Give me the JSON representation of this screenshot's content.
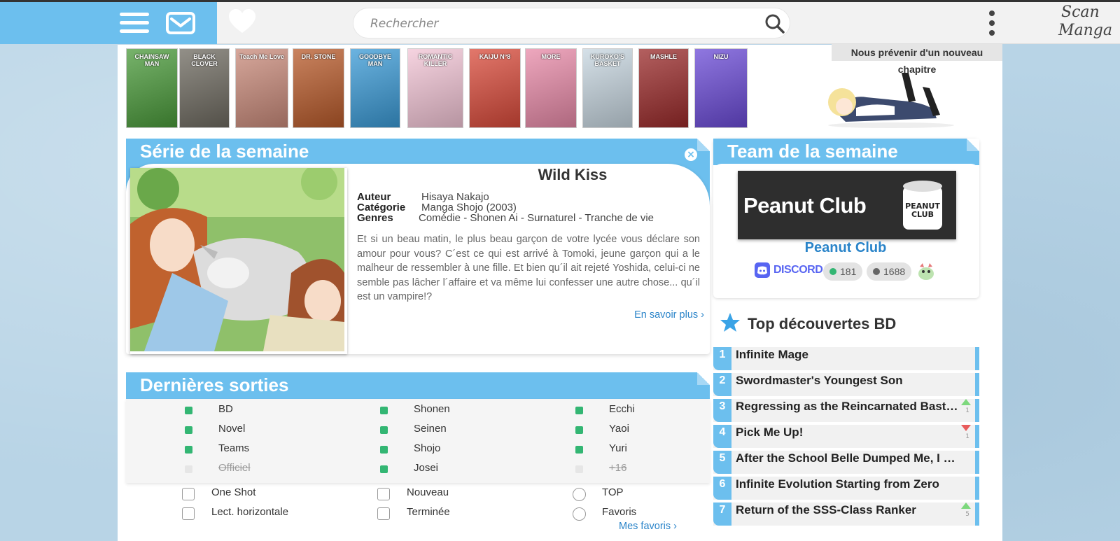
{
  "header": {
    "search_placeholder": "Rechercher",
    "logo_line1": "Scan",
    "logo_line2": "Manga"
  },
  "covers": [
    {
      "title": "CHAINSAW MAN",
      "color": "#4a9a3a"
    },
    {
      "title": "BLACK CLOVER",
      "color": "#6e6a60"
    },
    {
      "title": "Teach Me Love",
      "color": "#c98a7a"
    },
    {
      "title": "DR. STONE",
      "color": "#b85a2a"
    },
    {
      "title": "GOODBYE MAN",
      "color": "#3a9ad6"
    },
    {
      "title": "ROMANTIC KILLER",
      "color": "#f3c5d6"
    },
    {
      "title": "KAIJU N°8",
      "color": "#d94a3a"
    },
    {
      "title": "MORE",
      "color": "#e88aa8"
    },
    {
      "title": "KUROKO'S BASKET",
      "color": "#c7d6e0"
    },
    {
      "title": "MASHLE",
      "color": "#9a2a2a"
    },
    {
      "title": "NIZU",
      "color": "#6a4ad6"
    }
  ],
  "notify_label": "Nous prévenir d'un nouveau chapitre",
  "serie": {
    "heading": "Série de la semaine",
    "title": "Wild Kiss",
    "auteur_label": "Auteur",
    "auteur": "Hisaya Nakajo",
    "categorie_label": "Catégorie",
    "categorie": "Manga Shojo (2003)",
    "genres_label": "Genres",
    "genres": "Comédie - Shonen Ai - Surnaturel - Tranche de vie",
    "synopsis": "Et si un beau matin, le plus beau garçon de votre lycée vous déclare son amour pour vous? C´est ce qui est arrivé à Tomoki, jeune garçon qui a le malheur de ressembler à une fille. Et bien qu´il ait rejeté Yoshida, celui-ci ne semble pas lâcher l´affaire et va même lui confesser une autre chose... qu´il est un vampire!?",
    "more_label": "En savoir plus ›"
  },
  "team": {
    "heading": "Team de la semaine",
    "banner_text": "Peanut Club",
    "name": "Peanut Club",
    "discord_label": "DISCORD",
    "online": "181",
    "members": "1688",
    "online_color": "#33b673",
    "members_color": "#666666"
  },
  "top": {
    "heading": "Top découvertes BD",
    "items": [
      {
        "rank": "1",
        "name": "Infinite Mage",
        "trend": ""
      },
      {
        "rank": "2",
        "name": "Swordmaster's Youngest Son",
        "trend": ""
      },
      {
        "rank": "3",
        "name": "Regressing as the Reincarnated Bastard of the Sword Clan",
        "trend": "up",
        "delta": "1"
      },
      {
        "rank": "4",
        "name": "Pick Me Up!",
        "trend": "down",
        "delta": "1"
      },
      {
        "rank": "5",
        "name": "After the School Belle Dumped Me, I Became a Hot Topic",
        "trend": ""
      },
      {
        "rank": "6",
        "name": "Infinite Evolution Starting from Zero",
        "trend": ""
      },
      {
        "rank": "7",
        "name": "Return of the SSS-Class Ranker",
        "trend": "up",
        "delta": "5"
      }
    ]
  },
  "sorties": {
    "heading": "Dernières sorties",
    "col1": [
      {
        "label": "BD",
        "on": true
      },
      {
        "label": "Novel",
        "on": true
      },
      {
        "label": "Teams",
        "on": true
      },
      {
        "label": "Officiel",
        "on": false
      }
    ],
    "col2": [
      {
        "label": "Shonen",
        "on": true
      },
      {
        "label": "Seinen",
        "on": true
      },
      {
        "label": "Shojo",
        "on": true
      },
      {
        "label": "Josei",
        "on": true
      }
    ],
    "col3": [
      {
        "label": "Ecchi",
        "on": true
      },
      {
        "label": "Yaoi",
        "on": true
      },
      {
        "label": "Yuri",
        "on": true
      },
      {
        "label": "+16",
        "on": false
      }
    ],
    "options": {
      "one_shot": "One Shot",
      "lect_horizontale": "Lect. horizontale",
      "nouveau": "Nouveau",
      "terminee": "Terminée",
      "top": "TOP",
      "favoris": "Favoris",
      "mes_favoris": "Mes favoris ›"
    }
  }
}
